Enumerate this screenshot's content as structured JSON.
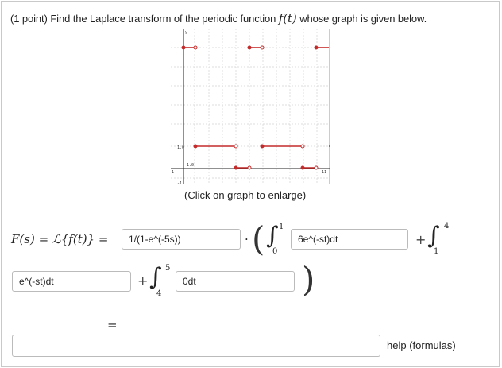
{
  "problem": {
    "points_label": "(1 point)",
    "text_before": "Find the Laplace transform of the periodic function",
    "function_name": "f(t)",
    "text_after": "whose graph is given below."
  },
  "graph": {
    "caption": "(Click on graph to enlarge)",
    "tick_labels": {
      "y_top": "y",
      "y_upper": "1.0",
      "y_mid": "1.0",
      "x_left": "-1",
      "x_right": "11",
      "y_bottom": "-1"
    },
    "segment_color": "#c42b2b"
  },
  "equation": {
    "lhs": "F(s) = ℒ{f(t)} =",
    "factor_input": "1/(1-e^(-5s))",
    "dot": "·",
    "integral1": {
      "lower": "0",
      "upper": "1",
      "integrand": "6e^(-st)dt"
    },
    "plus1": "+",
    "integral2": {
      "lower": "1",
      "upper": "4",
      "integrand": "e^(-st)dt"
    },
    "plus2": "+",
    "integral3": {
      "lower": "4",
      "upper": "5",
      "integrand": "0dt"
    },
    "equals": "=",
    "final_answer": ""
  },
  "help": {
    "label": "help (formulas)"
  }
}
